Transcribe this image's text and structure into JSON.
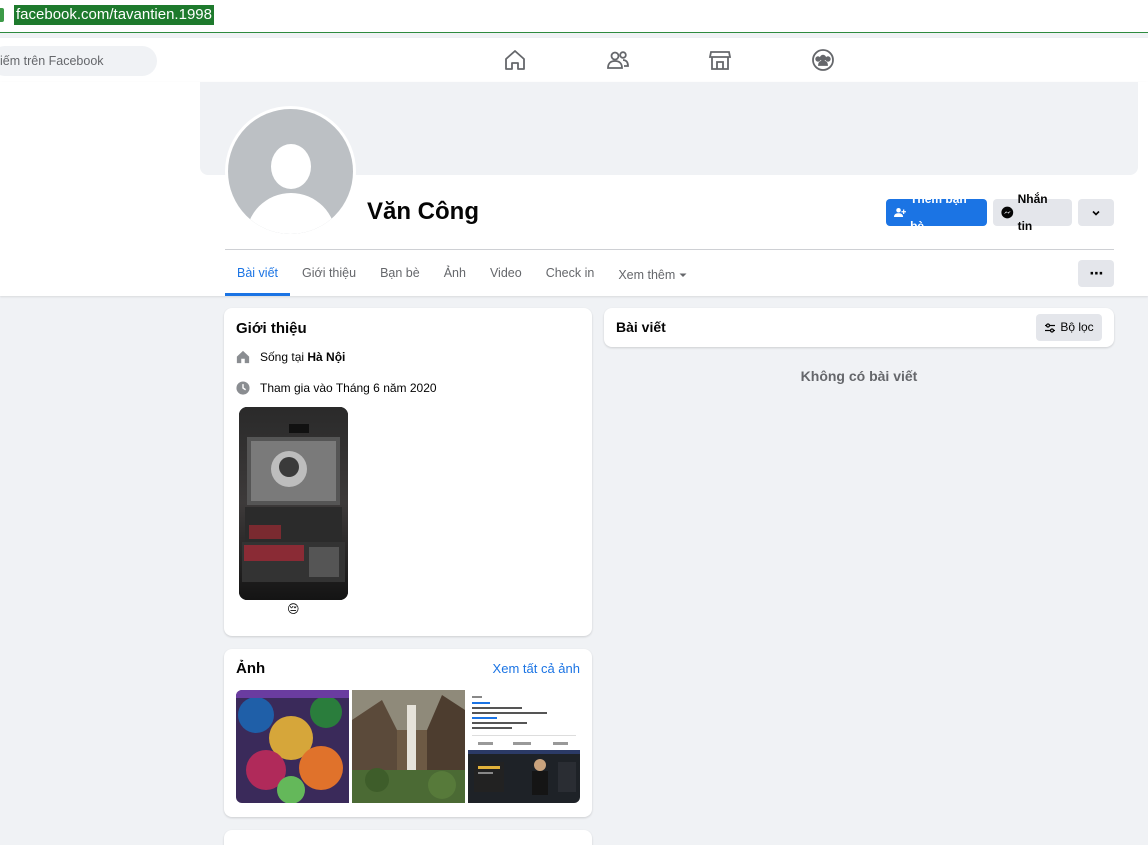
{
  "browser": {
    "url": "facebook.com/tavantien.1998"
  },
  "topnav": {
    "search_placeholder": "iếm trên Facebook",
    "icons": [
      "home-icon",
      "friends-icon",
      "marketplace-icon",
      "groups-icon"
    ]
  },
  "profile": {
    "name": "Văn Công",
    "add_friend_label": "Thêm bạn bè",
    "message_label": "Nhắn tin",
    "tabs": [
      "Bài viết",
      "Giới thiệu",
      "Bạn bè",
      "Ảnh",
      "Video",
      "Check in",
      "Xem thêm"
    ]
  },
  "intro": {
    "title": "Giới thiệu",
    "lives_prefix": "Sống tại ",
    "lives_place": "Hà Nội",
    "joined": "Tham gia vào Tháng 6 năm 2020",
    "featured_emoji": "😔"
  },
  "photos": {
    "title": "Ảnh",
    "see_all": "Xem tất cả ảnh"
  },
  "posts": {
    "title": "Bài viết",
    "filter_label": "Bộ lọc",
    "empty": "Không có bài viết"
  }
}
